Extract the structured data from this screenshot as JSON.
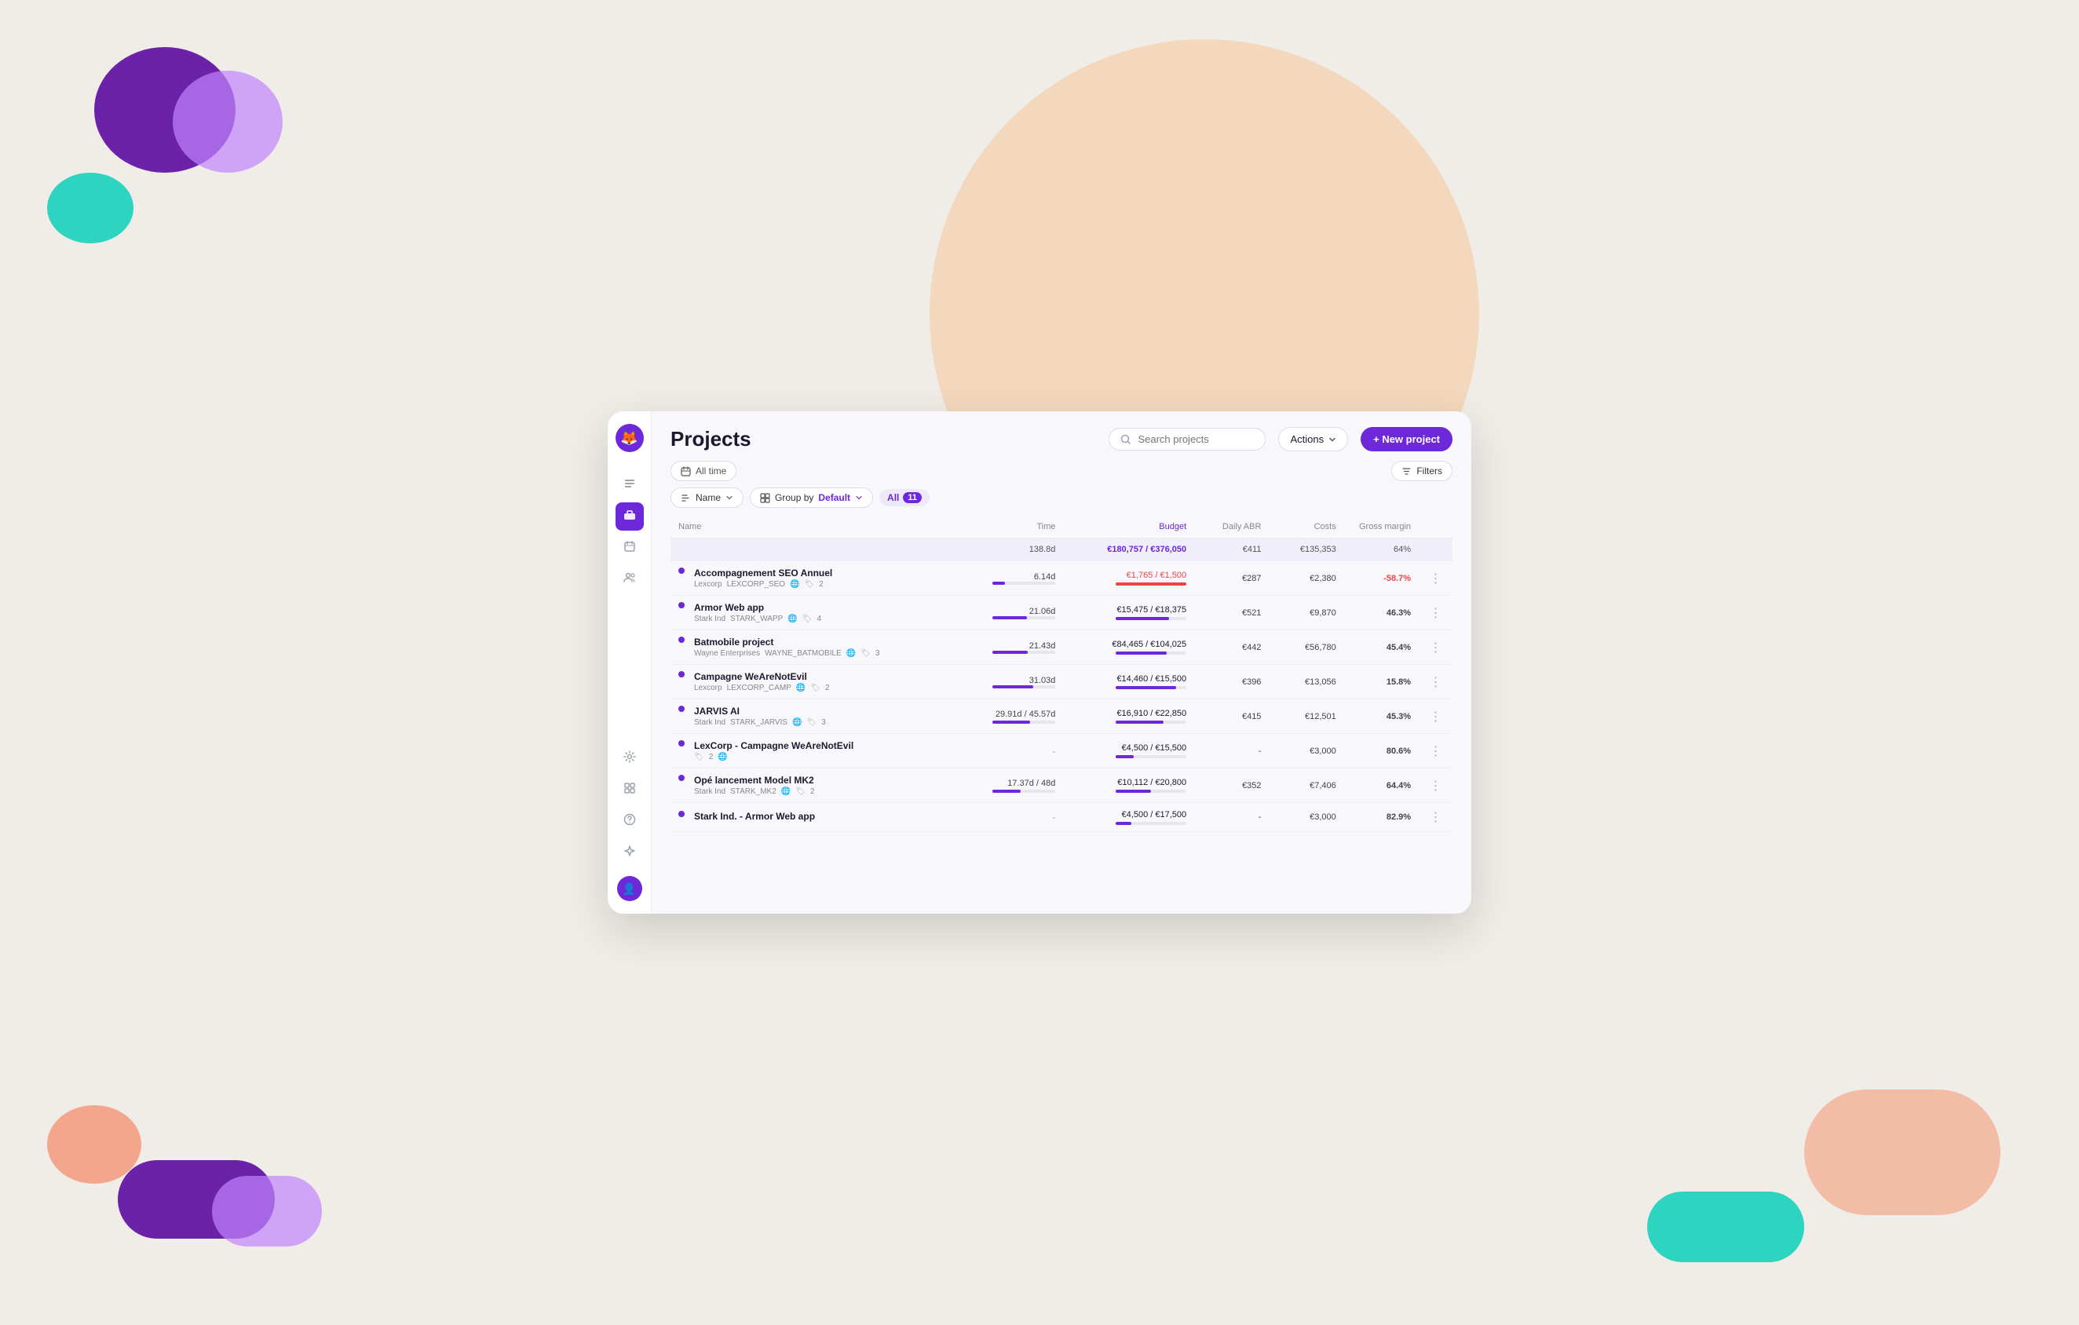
{
  "app": {
    "title": "Projects",
    "logo_emoji": "🦊"
  },
  "header": {
    "search_placeholder": "Search projects",
    "actions_label": "Actions",
    "new_project_label": "+ New project"
  },
  "toolbar": {
    "all_time_label": "All time",
    "filters_label": "Filters"
  },
  "filters": {
    "sort_label": "Name",
    "group_label": "Group by",
    "group_value": "Default",
    "badge_label": "All",
    "badge_count": "11"
  },
  "table": {
    "columns": [
      "Name",
      "Time",
      "Budget",
      "Daily ABR",
      "Costs",
      "Gross margin"
    ],
    "summary": {
      "time": "138.8d",
      "budget": "€180,757 / €376,050",
      "daily_abr": "€411",
      "costs": "€135,353",
      "gross_margin": "64%"
    },
    "rows": [
      {
        "name": "Accompagnement SEO Annuel",
        "company": "Lexcorp",
        "code": "LEXCORP_SEO",
        "tags": 2,
        "time": "6.14d",
        "time_bar": 20,
        "budget": "€1,765 / €1,500",
        "budget_bar": 110,
        "budget_negative": true,
        "daily_abr": "€287",
        "costs": "€2,380",
        "gross_margin": "-58.7%",
        "gross_negative": true
      },
      {
        "name": "Armor Web app",
        "company": "Stark Ind",
        "code": "STARK_WAPP",
        "tags": 4,
        "time": "21.06d",
        "time_bar": 55,
        "budget": "€15,475 / €18,375",
        "budget_bar": 75,
        "budget_negative": false,
        "daily_abr": "€521",
        "costs": "€9,870",
        "gross_margin": "46.3%",
        "gross_negative": false
      },
      {
        "name": "Batmobile project",
        "company": "Wayne Enterprises",
        "code": "WAYNE_BATMOBILE",
        "tags": 3,
        "time": "21.43d",
        "time_bar": 56,
        "budget": "€84,465 / €104,025",
        "budget_bar": 72,
        "budget_negative": false,
        "daily_abr": "€442",
        "costs": "€56,780",
        "gross_margin": "45.4%",
        "gross_negative": false
      },
      {
        "name": "Campagne WeAreNotEvil",
        "company": "Lexcorp",
        "code": "LEXCORP_CAMP",
        "tags": 2,
        "time": "31.03d",
        "time_bar": 65,
        "budget": "€14,460 / €15,500",
        "budget_bar": 85,
        "budget_negative": false,
        "daily_abr": "€396",
        "costs": "€13,056",
        "gross_margin": "15.8%",
        "gross_negative": false
      },
      {
        "name": "JARVIS AI",
        "company": "Stark Ind",
        "code": "STARK_JARVIS",
        "tags": 3,
        "time": "29.91d / 45.57d",
        "time_bar": 60,
        "budget": "€16,910 / €22,850",
        "budget_bar": 68,
        "budget_negative": false,
        "daily_abr": "€415",
        "costs": "€12,501",
        "gross_margin": "45.3%",
        "gross_negative": false
      },
      {
        "name": "LexCorp - Campagne WeAreNotEvil",
        "company": "",
        "code": "",
        "tags": 2,
        "time": "-",
        "time_bar": 0,
        "budget": "€4,500 / €15,500",
        "budget_bar": 25,
        "budget_negative": false,
        "daily_abr": "-",
        "costs": "€3,000",
        "gross_margin": "80.6%",
        "gross_negative": false
      },
      {
        "name": "Opé lancement Model MK2",
        "company": "Stark Ind",
        "code": "STARK_MK2",
        "tags": 2,
        "time": "17.37d / 48d",
        "time_bar": 45,
        "budget": "€10,112 / €20,800",
        "budget_bar": 50,
        "budget_negative": false,
        "daily_abr": "€352",
        "costs": "€7,406",
        "gross_margin": "64.4%",
        "gross_negative": false
      },
      {
        "name": "Stark Ind. - Armor Web app",
        "company": "",
        "code": "",
        "tags": 0,
        "time": "-",
        "time_bar": 0,
        "budget": "€4,500 / €17,500",
        "budget_bar": 22,
        "budget_negative": false,
        "daily_abr": "-",
        "costs": "€3,000",
        "gross_margin": "82.9%",
        "gross_negative": false
      }
    ]
  },
  "sidebar": {
    "items": [
      {
        "icon": "📋",
        "name": "list-icon"
      },
      {
        "icon": "💼",
        "name": "briefcase-icon",
        "active": true
      },
      {
        "icon": "📅",
        "name": "calendar-icon"
      },
      {
        "icon": "👥",
        "name": "users-icon"
      },
      {
        "icon": "⚙️",
        "name": "settings-icon"
      },
      {
        "icon": "🗂️",
        "name": "files-icon"
      },
      {
        "icon": "❓",
        "name": "help-icon"
      },
      {
        "icon": "✨",
        "name": "sparkle-icon"
      }
    ]
  }
}
